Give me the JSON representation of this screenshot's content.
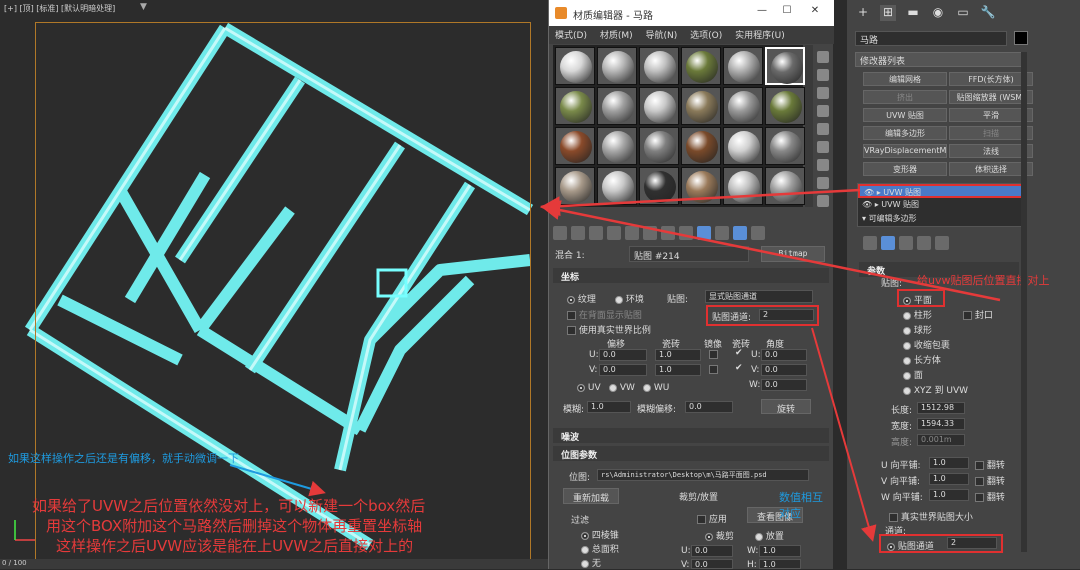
{
  "viewport": {
    "label": "[+] [顶] [标准] [默认明暗处理]",
    "progress": "0 / 100"
  },
  "notes": {
    "blue": "如果这样操作之后还是有偏移，就手动微调一下",
    "red": [
      "如果给了UVW之后位置依然没对上，可以新建一个box然后",
      "用这个BOX附加这个马路然后删掉这个物体再重置坐标轴",
      "这样操作之后UVW应该是能在上UVW之后直接对上的"
    ],
    "align": "数值相互对应",
    "panel_note": "给uvw贴图后位置直接对上"
  },
  "mat": {
    "title": "材质编辑器 - 马路",
    "min": "—",
    "max": "☐",
    "close": "✕",
    "menu": [
      "模式(D)",
      "材质(M)",
      "导航(N)",
      "选项(O)",
      "实用程序(U)"
    ],
    "slots": [
      "#d8d8d8",
      "#b8b8b8",
      "#c0c0c0",
      "#6b7a3a",
      "#b0b0b0",
      "#6a6a6a",
      "#7a8a4a",
      "#a0a0a0",
      "#c8c8c8",
      "#8a7a5a",
      "#9a9a9a",
      "#6a7a3a",
      "#8a4a2a",
      "#a8a8a8",
      "#808080",
      "#7a4a2a",
      "#d0d0d0",
      "#888888",
      "#a89a8a",
      "#c8c8c8",
      "#303030",
      "#9a7a5a",
      "#c0c0c0",
      "#a0a0a0"
    ],
    "mix_label": "混合 1:",
    "map_name": "贴图 #214",
    "bitmap": "Bitmap",
    "coords": {
      "title": "坐标",
      "texture": "纹理",
      "env": "环境",
      "map_label": "贴图:",
      "map_mode": "显式贴图通道",
      "show_back": "在背面显示贴图",
      "channel_label": "贴图通道:",
      "channel": "2",
      "real_world": "使用真实世界比例",
      "offset": "偏移",
      "tiling": "瓷砖",
      "mirror": "镜像",
      "tile": "瓷砖",
      "angle": "角度",
      "u": "U:",
      "v": "V:",
      "w": "W:",
      "u_off": "0.0",
      "v_off": "0.0",
      "u_tile": "1.0",
      "v_tile": "1.0",
      "u_ang": "0.0",
      "v_ang": "0.0",
      "w_ang": "0.0",
      "uv": "UV",
      "vw": "VW",
      "wu": "WU",
      "blur": "模糊:",
      "blur_val": "1.0",
      "blur_off": "模糊偏移:",
      "blur_off_val": "0.0",
      "rotate": "旋转"
    },
    "noise": "噪波",
    "bitmap_params": {
      "title": "位图参数",
      "path_label": "位图:",
      "path": "rs\\Administrator\\Desktop\\m\\马路平面图.psd",
      "reload": "重新加载",
      "crop": "裁剪/放置",
      "apply": "应用",
      "view": "查看图像",
      "filter": "过滤",
      "f1": "四棱锥",
      "f2": "总面积",
      "f3": "无",
      "crop_r": "裁剪",
      "place_r": "放置",
      "u": "U:",
      "w": "W:",
      "v": "V:",
      "h": "H:",
      "uval": "0.0",
      "wval": "1.0",
      "vval": "0.0",
      "hval": "1.0"
    }
  },
  "cmd": {
    "tabs": [
      "+",
      "⊞",
      "▬",
      "◉",
      "▭",
      "🔧"
    ],
    "object_name": "马路",
    "modifier_list": "修改器列表",
    "buttons": [
      [
        "编辑网格",
        "FFD(长方体)"
      ],
      [
        "挤出",
        "贴图缩放器 (WSM)"
      ],
      [
        "UVW 贴图",
        "平滑"
      ],
      [
        "编辑多边形",
        "扫描"
      ],
      [
        "VRayDisplacementM",
        "法线"
      ],
      [
        "变形器",
        "体积选择"
      ]
    ],
    "stack": [
      "UVW 贴图",
      "UVW 贴图",
      "可编辑多边形"
    ],
    "params": "参数",
    "map_label": "贴图:",
    "types": [
      "平面",
      "柱形",
      "球形",
      "收缩包裹",
      "长方体",
      "面",
      "XYZ 到 UVW"
    ],
    "cap": "封口",
    "length_label": "长度:",
    "length": "1512.98",
    "width_label": "宽度:",
    "width": "1594.33",
    "height_label": "高度:",
    "height": "0.001m",
    "u_tile": "U 向平铺:",
    "v_tile": "V 向平铺:",
    "w_tile": "W 向平铺:",
    "tile_val": "1.0",
    "flip": "翻转",
    "real_world": "真实世界贴图大小",
    "channel_title": "通道:",
    "channel_label": "贴图通道",
    "channel": "2"
  }
}
